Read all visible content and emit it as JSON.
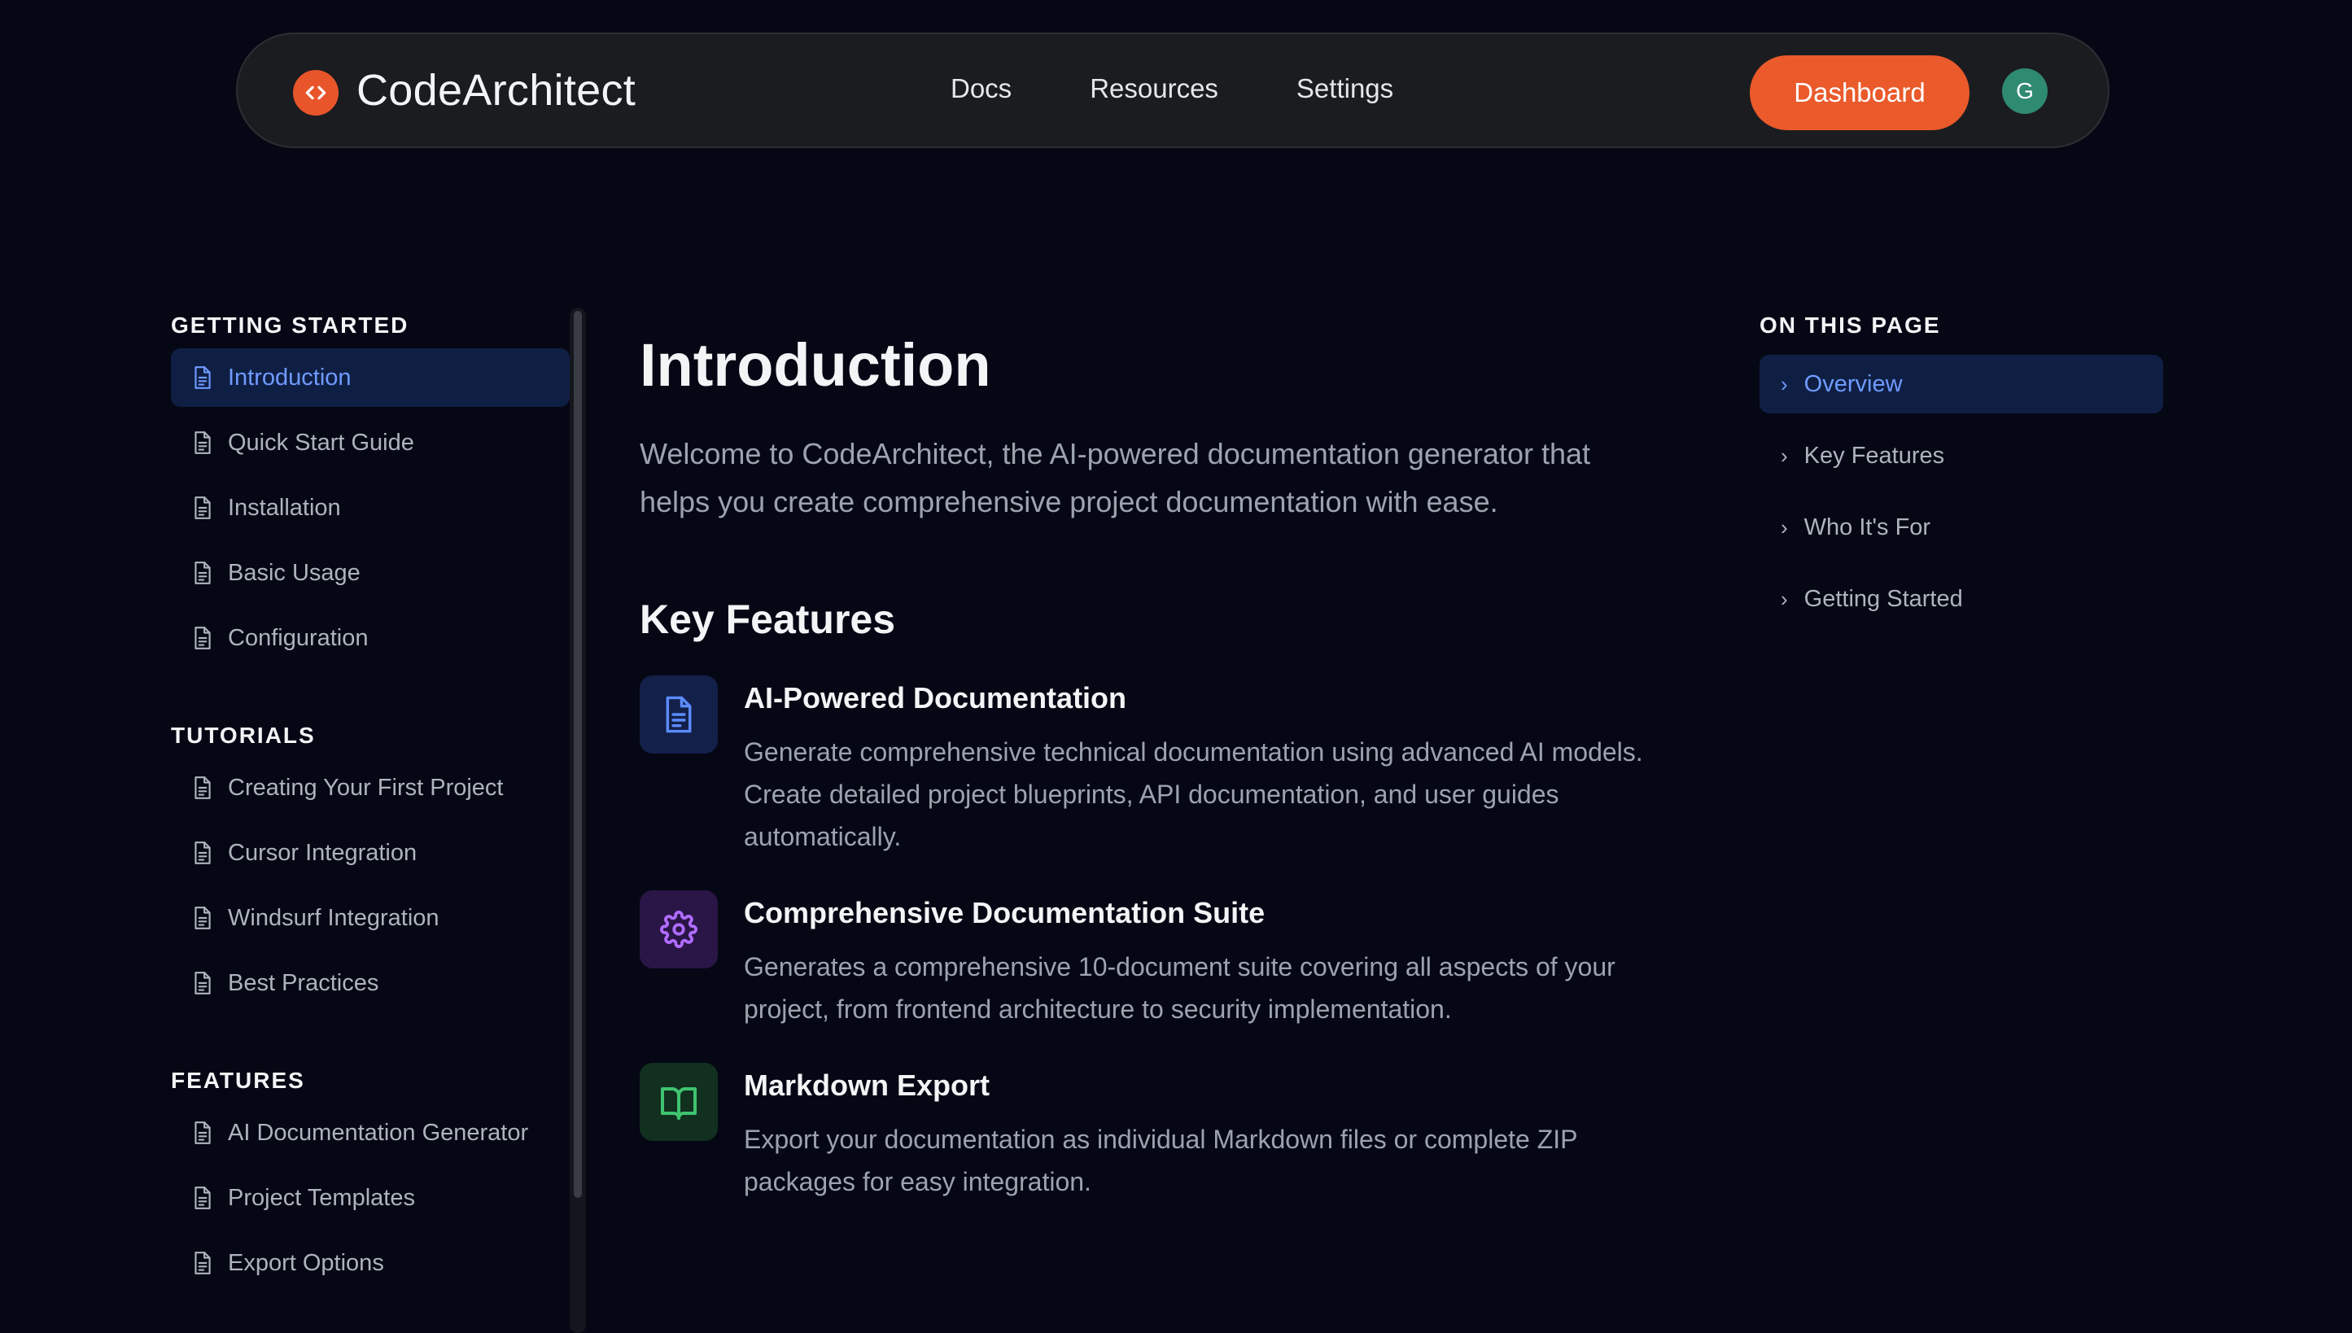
{
  "header": {
    "brand": "CodeArchitect",
    "nav": [
      "Docs",
      "Resources",
      "Settings"
    ],
    "dashboard_label": "Dashboard",
    "avatar_initial": "G"
  },
  "sidebar": {
    "sections": [
      {
        "title": "GETTING STARTED",
        "items": [
          {
            "label": "Introduction",
            "active": true
          },
          {
            "label": "Quick Start Guide"
          },
          {
            "label": "Installation"
          },
          {
            "label": "Basic Usage"
          },
          {
            "label": "Configuration"
          }
        ]
      },
      {
        "title": "TUTORIALS",
        "items": [
          {
            "label": "Creating Your First Project"
          },
          {
            "label": "Cursor Integration"
          },
          {
            "label": "Windsurf Integration"
          },
          {
            "label": "Best Practices"
          }
        ]
      },
      {
        "title": "FEATURES",
        "items": [
          {
            "label": "AI Documentation Generator"
          },
          {
            "label": "Project Templates"
          },
          {
            "label": "Export Options"
          }
        ]
      }
    ]
  },
  "main": {
    "title": "Introduction",
    "lead": "Welcome to CodeArchitect, the AI-powered documentation generator that helps you create comprehensive project documentation with ease.",
    "key_features_heading": "Key Features",
    "features": [
      {
        "icon": "document-icon",
        "color": "#5b8cff",
        "bg": "#13204a",
        "title": "AI-Powered Documentation",
        "desc": "Generate comprehensive technical documentation using advanced AI models. Create detailed project blueprints, API documentation, and user guides automatically."
      },
      {
        "icon": "gear-icon",
        "color": "#b06cff",
        "bg": "#2a1547",
        "title": "Comprehensive Documentation Suite",
        "desc": "Generates a comprehensive 10-document suite covering all aspects of your project, from frontend architecture to security implementation."
      },
      {
        "icon": "book-icon",
        "color": "#3fc470",
        "bg": "#11301f",
        "title": "Markdown Export",
        "desc": "Export your documentation as individual Markdown files or complete ZIP packages for easy integration."
      }
    ]
  },
  "toc": {
    "title": "ON THIS PAGE",
    "items": [
      {
        "label": "Overview",
        "active": true
      },
      {
        "label": "Key Features"
      },
      {
        "label": "Who It's For"
      },
      {
        "label": "Getting Started"
      }
    ]
  },
  "colors": {
    "accent": "#ea5a2b",
    "link_active": "#6f9bff",
    "background": "#050814"
  }
}
